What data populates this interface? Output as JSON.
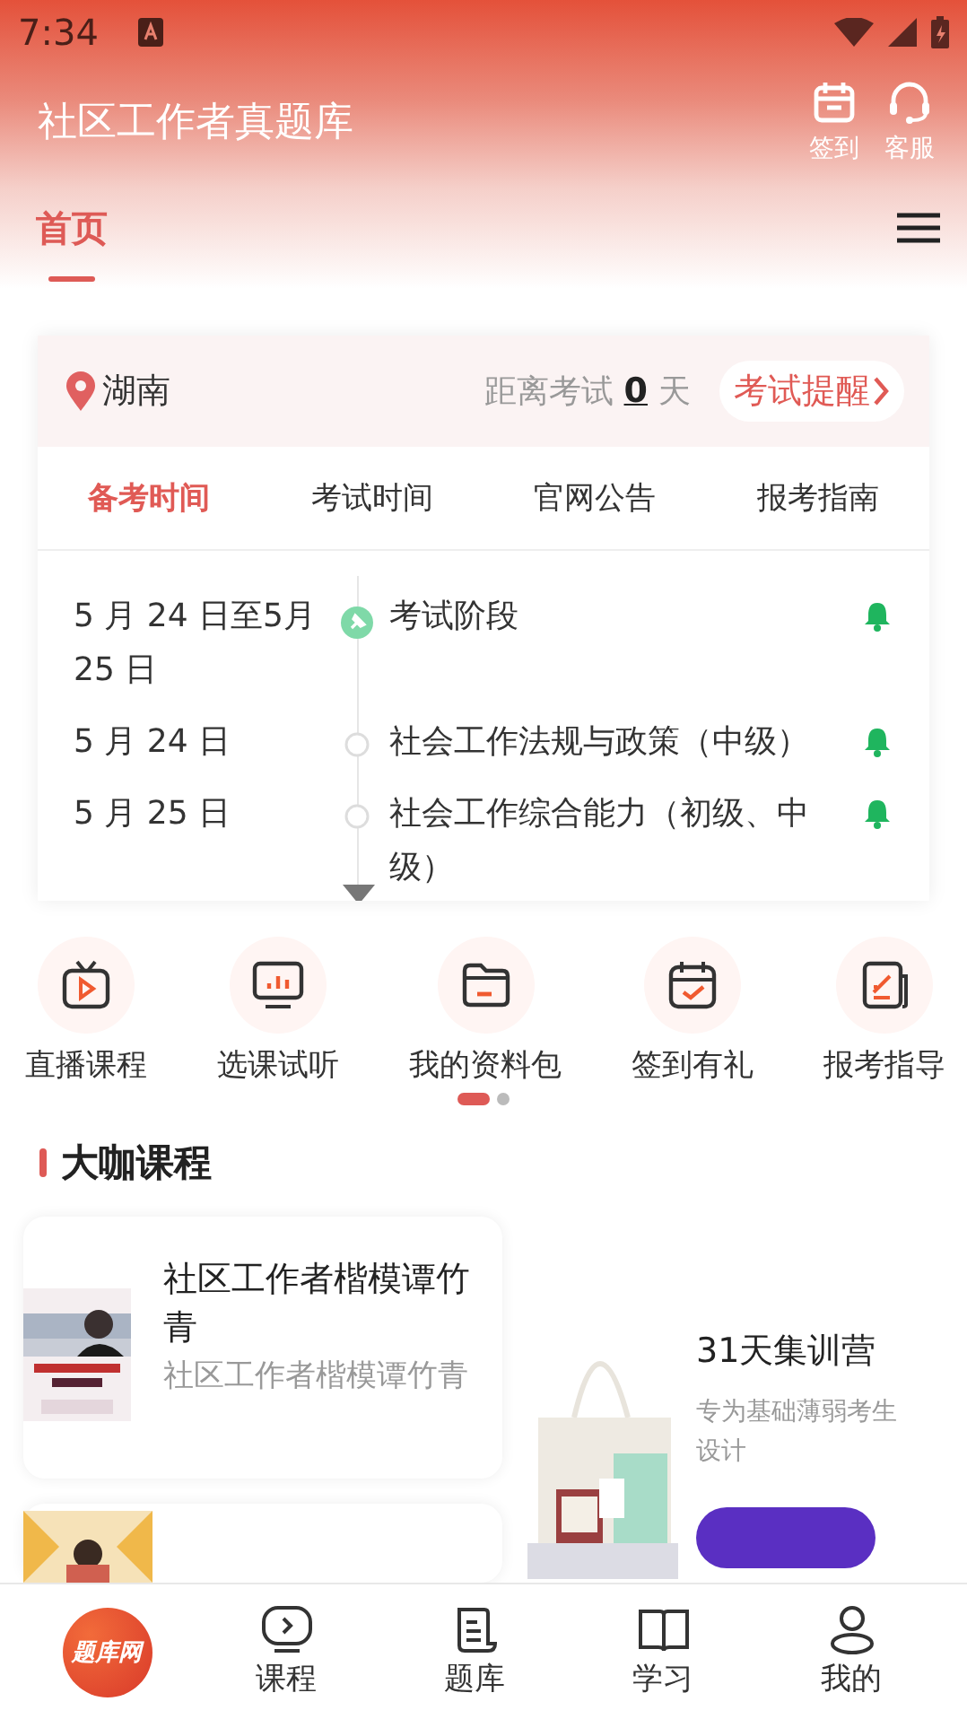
{
  "status_bar": {
    "time": "7:34"
  },
  "header": {
    "title": "社区工作者真题库",
    "actions": [
      {
        "kind": "calendar",
        "label": "签到"
      },
      {
        "kind": "headset",
        "label": "客服"
      }
    ]
  },
  "top_tabs": [
    {
      "label": "首页",
      "selected": true
    }
  ],
  "exam_card": {
    "region": "湖南",
    "countdown_label": "距离考试",
    "countdown_value": "0",
    "countdown_unit": "天",
    "reminder_button": "考试提醒",
    "tabs": [
      {
        "label": "备考时间",
        "selected": true
      },
      {
        "label": "考试时间",
        "selected": false
      },
      {
        "label": "官网公告",
        "selected": false
      },
      {
        "label": "报考指南",
        "selected": false
      }
    ],
    "timeline": [
      {
        "date": "5 月 24 日至5月 25 日",
        "event": "考试阶段",
        "current": true
      },
      {
        "date": "5 月 24 日",
        "event": "社会工作法规与政策（中级）",
        "current": false
      },
      {
        "date": "5 月 25 日",
        "event": "社会工作综合能力（初级、中级）",
        "current": false
      }
    ]
  },
  "shortcuts": [
    {
      "kind": "tv",
      "label": "直播课程"
    },
    {
      "kind": "monitor",
      "label": "选课试听"
    },
    {
      "kind": "folder",
      "label": "我的资料包"
    },
    {
      "kind": "calendar",
      "label": "签到有礼"
    },
    {
      "kind": "doc",
      "label": "报考指导"
    }
  ],
  "pager": [
    {
      "selected": true
    },
    {
      "selected": false
    }
  ],
  "section_title": "大咖课程",
  "courses": [
    {
      "kind": "full",
      "title": "社区工作者楷模谭竹青",
      "subtitle": "社区工作者楷模谭竹青"
    },
    {
      "kind": "partial"
    }
  ],
  "promo": {
    "title": "31天集训营",
    "description": "专为基础薄弱考生设计"
  },
  "bottom_nav": [
    {
      "kind": "logo",
      "label": "题库网"
    },
    {
      "kind": "play",
      "label": "课程"
    },
    {
      "kind": "paper",
      "label": "题库"
    },
    {
      "kind": "book",
      "label": "学习"
    },
    {
      "kind": "person",
      "label": "我的"
    }
  ]
}
